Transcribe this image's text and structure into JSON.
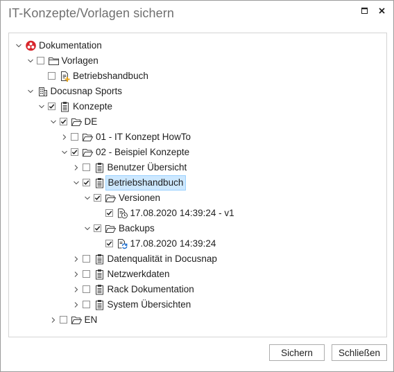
{
  "window": {
    "title": "IT-Konzepte/Vorlagen sichern"
  },
  "tree": {
    "rows": [
      {
        "label": "Dokumentation",
        "level": 0,
        "expanded": true,
        "checkbox": false,
        "checked": false,
        "icon": "docunsap-logo-icon",
        "selected": false
      },
      {
        "label": "Vorlagen",
        "level": 1,
        "expanded": true,
        "checkbox": true,
        "checked": false,
        "icon": "folder-icon",
        "selected": false
      },
      {
        "label": "Betriebshandbuch",
        "level": 2,
        "expanded": null,
        "checkbox": true,
        "checked": false,
        "icon": "template-document-icon",
        "selected": false
      },
      {
        "label": "Docusnap Sports",
        "level": 1,
        "expanded": true,
        "checkbox": false,
        "checked": false,
        "icon": "building-icon",
        "selected": false
      },
      {
        "label": "Konzepte",
        "level": 2,
        "expanded": true,
        "checkbox": true,
        "checked": true,
        "icon": "clipboard-icon",
        "selected": false
      },
      {
        "label": "DE",
        "level": 3,
        "expanded": true,
        "checkbox": true,
        "checked": true,
        "icon": "folder-open-icon",
        "selected": false
      },
      {
        "label": "01 - IT Konzept HowTo",
        "level": 4,
        "expanded": false,
        "checkbox": true,
        "checked": false,
        "icon": "folder-open-icon",
        "selected": false
      },
      {
        "label": "02 - Beispiel Konzepte",
        "level": 4,
        "expanded": true,
        "checkbox": true,
        "checked": true,
        "icon": "folder-open-icon",
        "selected": false
      },
      {
        "label": "Benutzer Übersicht",
        "level": 5,
        "expanded": false,
        "checkbox": true,
        "checked": false,
        "icon": "clipboard-icon",
        "selected": false
      },
      {
        "label": "Betriebshandbuch",
        "level": 5,
        "expanded": true,
        "checkbox": true,
        "checked": true,
        "icon": "clipboard-icon",
        "selected": true
      },
      {
        "label": "Versionen",
        "level": 6,
        "expanded": true,
        "checkbox": true,
        "checked": true,
        "icon": "folder-open-icon",
        "selected": false
      },
      {
        "label": "17.08.2020 14:39:24 - v1",
        "level": 7,
        "expanded": null,
        "checkbox": true,
        "checked": true,
        "icon": "version-clock-icon",
        "selected": false
      },
      {
        "label": "Backups",
        "level": 6,
        "expanded": true,
        "checkbox": true,
        "checked": true,
        "icon": "folder-open-icon",
        "selected": false
      },
      {
        "label": "17.08.2020 14:39:24",
        "level": 7,
        "expanded": null,
        "checkbox": true,
        "checked": true,
        "icon": "backup-restore-icon",
        "selected": false
      },
      {
        "label": "Datenqualität in Docusnap",
        "level": 5,
        "expanded": false,
        "checkbox": true,
        "checked": false,
        "icon": "clipboard-icon",
        "selected": false
      },
      {
        "label": "Netzwerkdaten",
        "level": 5,
        "expanded": false,
        "checkbox": true,
        "checked": false,
        "icon": "clipboard-icon",
        "selected": false
      },
      {
        "label": "Rack Dokumentation",
        "level": 5,
        "expanded": false,
        "checkbox": true,
        "checked": false,
        "icon": "clipboard-icon",
        "selected": false
      },
      {
        "label": "System Übersichten",
        "level": 5,
        "expanded": false,
        "checkbox": true,
        "checked": false,
        "icon": "clipboard-icon",
        "selected": false
      },
      {
        "label": "EN",
        "level": 3,
        "expanded": false,
        "checkbox": true,
        "checked": false,
        "icon": "folder-open-icon",
        "selected": false
      }
    ]
  },
  "buttons": {
    "save": "Sichern",
    "close": "Schließen"
  }
}
